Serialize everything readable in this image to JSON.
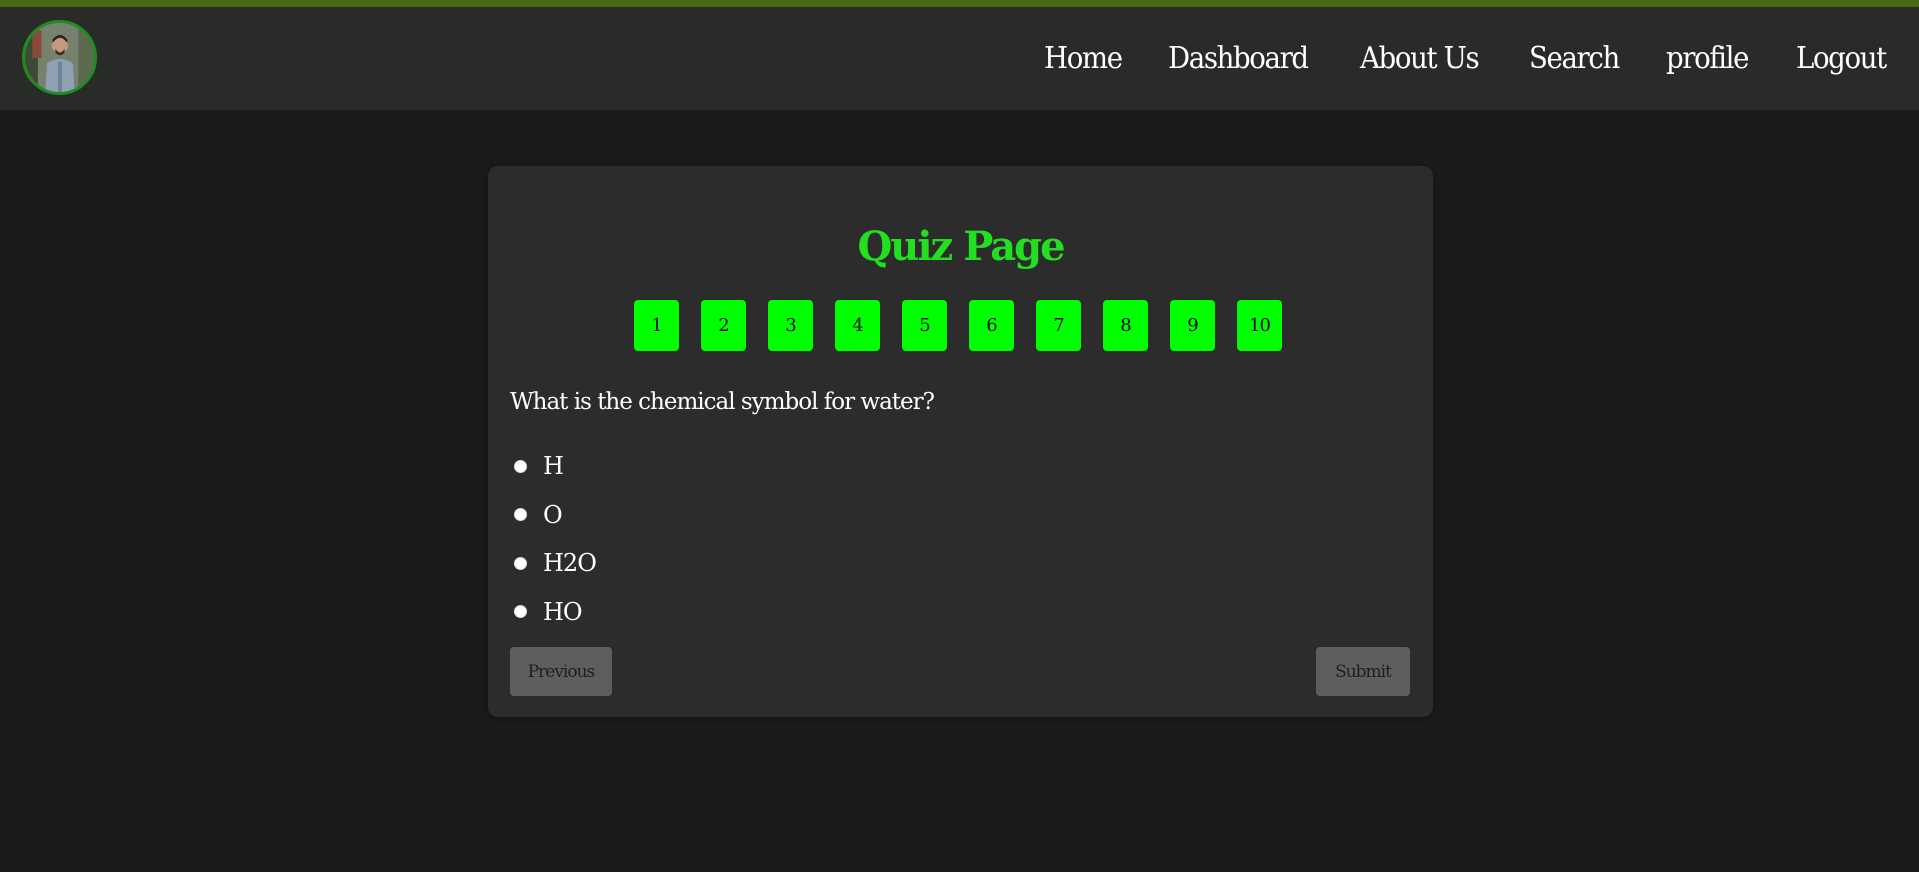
{
  "navbar": {
    "links": [
      "Home",
      "Dashboard",
      "About Us",
      "Search",
      "profile",
      "Logout"
    ]
  },
  "quiz": {
    "title": "Quiz Page",
    "question_numbers": [
      "1",
      "2",
      "3",
      "4",
      "5",
      "6",
      "7",
      "8",
      "9",
      "10"
    ],
    "question": "What is the chemical symbol for water?",
    "options": [
      "H",
      "O",
      "H2O",
      "HO"
    ],
    "previous_label": "Previous",
    "submit_label": "Submit"
  },
  "colors": {
    "accent_green": "#00ff00",
    "title_green": "#22e01f",
    "background": "#1b1b1b",
    "navbar": "#282b27",
    "card": "#2c2c2c"
  }
}
